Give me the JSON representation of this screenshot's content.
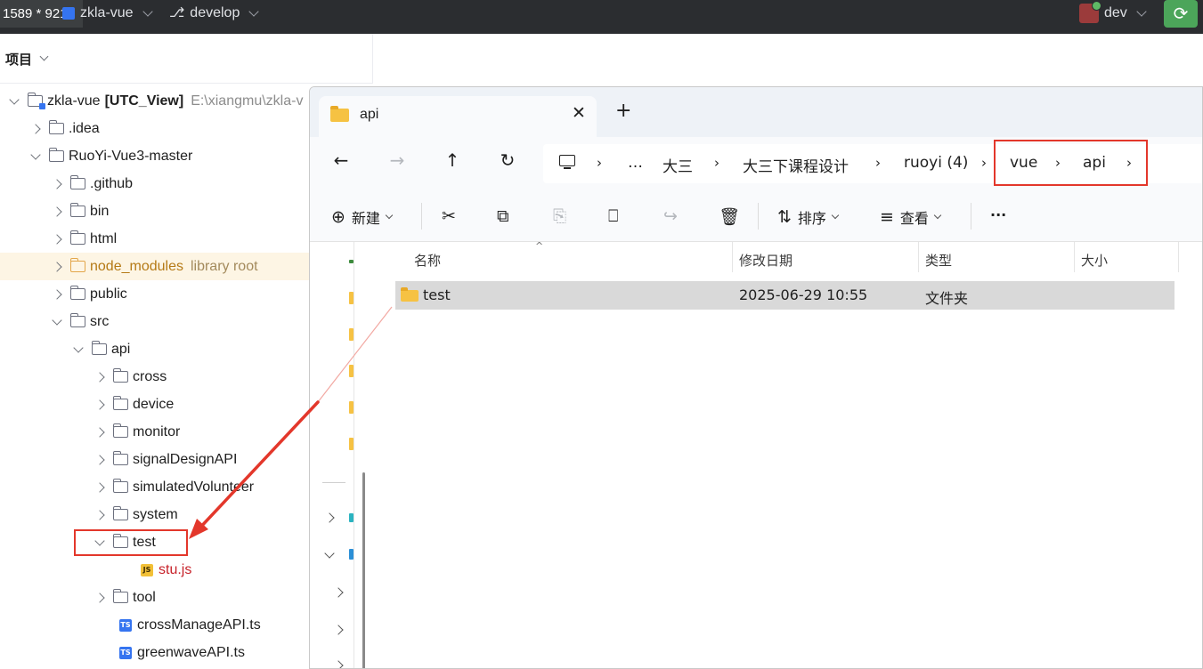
{
  "ide": {
    "dimensions_badge": "1589 * 921",
    "project_name": "zkla-vue",
    "branch": "develop",
    "user": "dev"
  },
  "project_panel": {
    "title": "项目",
    "tree": [
      {
        "label": "zkla-vue",
        "suffix": "[UTC_View]",
        "path": "E:\\xiangmu\\zkla-v",
        "arrow": "down",
        "kind": "module"
      },
      {
        "label": ".idea",
        "arrow": "right",
        "kind": "folder"
      },
      {
        "label": "RuoYi-Vue3-master",
        "arrow": "down",
        "kind": "folder"
      },
      {
        "label": ".github",
        "arrow": "right",
        "kind": "folder"
      },
      {
        "label": "bin",
        "arrow": "right",
        "kind": "folder"
      },
      {
        "label": "html",
        "arrow": "right",
        "kind": "folder"
      },
      {
        "label": "node_modules",
        "sub": "library root",
        "arrow": "right",
        "kind": "library"
      },
      {
        "label": "public",
        "arrow": "right",
        "kind": "folder"
      },
      {
        "label": "src",
        "arrow": "down",
        "kind": "folder"
      },
      {
        "label": "api",
        "arrow": "down",
        "kind": "folder"
      },
      {
        "label": "cross",
        "arrow": "right",
        "kind": "folder"
      },
      {
        "label": "device",
        "arrow": "right",
        "kind": "folder"
      },
      {
        "label": "monitor",
        "arrow": "right",
        "kind": "folder"
      },
      {
        "label": "signalDesignAPI",
        "arrow": "right",
        "kind": "folder"
      },
      {
        "label": "simulatedVolunteer",
        "arrow": "right",
        "kind": "folder"
      },
      {
        "label": "system",
        "arrow": "right",
        "kind": "folder"
      },
      {
        "label": "test",
        "arrow": "down",
        "kind": "folder"
      },
      {
        "label": "stu.js",
        "arrow": "none",
        "kind": "js"
      },
      {
        "label": "tool",
        "arrow": "right",
        "kind": "folder"
      },
      {
        "label": "crossManageAPI.ts",
        "arrow": "none",
        "kind": "ts"
      },
      {
        "label": "greenwaveAPI.ts",
        "arrow": "none",
        "kind": "ts"
      }
    ]
  },
  "explorer": {
    "tab_title": "api",
    "tab_close": "✕",
    "new_tab": "+",
    "nav": {
      "back": "←",
      "forward": "→",
      "up": "↑",
      "refresh": "↻"
    },
    "breadcrumb": [
      "…",
      "大三",
      "大三下课程设计",
      "ruoyi (4)",
      "vue",
      "api"
    ],
    "breadcrumb_sep": "›",
    "toolbar": {
      "new_label": "新建",
      "sort_label": "排序",
      "view_label": "查看",
      "more": "···"
    },
    "columns": [
      "名称",
      "修改日期",
      "类型",
      "大小"
    ],
    "files": [
      {
        "name": "test",
        "modified": "2025-06-29 10:55",
        "type": "文件夹",
        "size": ""
      }
    ]
  },
  "colors": {
    "annotation_red": "#e3372b",
    "ide_topbar": "#2b2d30",
    "folder_yellow": "#f6c243"
  }
}
